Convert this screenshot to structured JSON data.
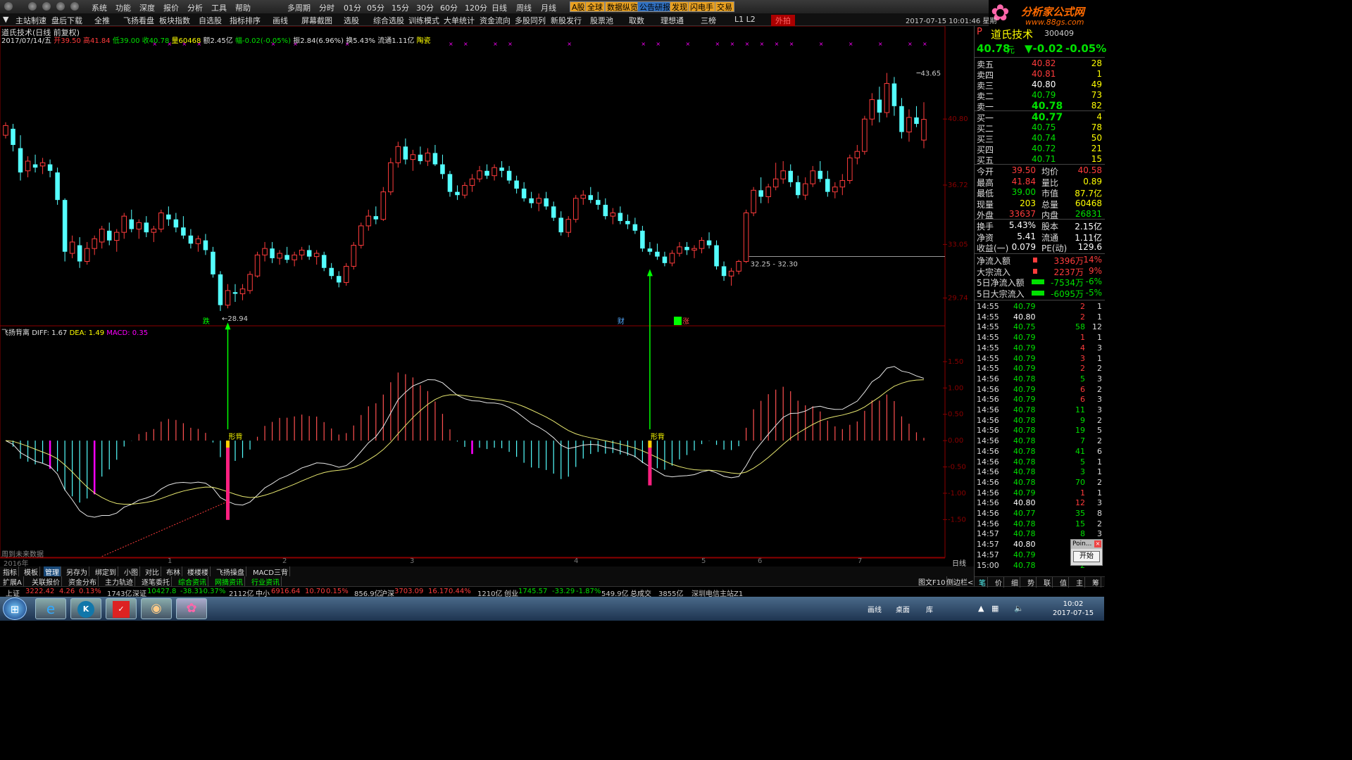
{
  "menu": [
    "系统",
    "功能",
    "深度",
    "报价",
    "分析",
    "工具",
    "帮助",
    "多周期",
    "分时",
    "01分",
    "05分",
    "15分",
    "30分",
    "60分",
    "120分",
    "日线",
    "周线",
    "月线"
  ],
  "badges": [
    {
      "label": "A股",
      "bg": "#e8a020"
    },
    {
      "label": "全球",
      "bg": "#e8a020"
    },
    {
      "label": "数据纵览",
      "bg": "#e8a020"
    },
    {
      "label": "公告研报",
      "bg": "#3070c0"
    },
    {
      "label": "发现",
      "bg": "#e8a020"
    },
    {
      "label": "闪电手",
      "bg": "#e8a020"
    },
    {
      "label": "交易",
      "bg": "#e8a020"
    }
  ],
  "logo": {
    "name": "分析家公式网",
    "url": "www.88gs.com"
  },
  "toolbar": [
    "主站制速",
    "盘后下载",
    "全推",
    "飞扬看盘",
    "板块指数",
    "自选股",
    "指标排序",
    "画线",
    "屏幕截图",
    "选股",
    "综合选股",
    "训练模式",
    "大单统计",
    "资金流向",
    "多股同列",
    "新股发行",
    "股票池",
    "取数",
    "理想通",
    "三榜",
    "L1 L2",
    "外拍"
  ],
  "datetime": "2017-07-15 10:01:46 星期",
  "stock": {
    "title": "道氏技术(日线 前复权)",
    "date": "2017/07/14/五",
    "open": "开39.50",
    "high": "高41.84",
    "low": "低39.00",
    "close": "收40.78",
    "volume": "量60468",
    "amount": "额2.45亿",
    "change": "幅-0.02(-0.05%)",
    "amplitude": "振2.84(6.96%)",
    "turnover": "换5.43%",
    "float": "流通1.11亿",
    "sector": "陶瓷"
  },
  "price_axis": [
    "40.80",
    "36.72",
    "33.05",
    "29.74"
  ],
  "macd_axis": [
    "1.50",
    "1.00",
    "0.50",
    "0.00",
    "-0.50",
    "-1.00",
    "-1.50"
  ],
  "indicator": {
    "name": "飞扬背离",
    "diff": "DIFF: 1.67",
    "dea": "DEA: 1.49",
    "macd": "MACD: 0.35"
  },
  "annotations": {
    "low_label": "←28.94",
    "high_label": "43.65",
    "range_label": "32.25 - 32.30",
    "die_label": "跌",
    "cai_label": "财",
    "zhang_label": "涨",
    "bei1": "形背",
    "bei2": "形背"
  },
  "future_note": "周到未来数据",
  "year_label": "2016年",
  "months": [
    "1",
    "2",
    "3",
    "4",
    "5",
    "6",
    "7"
  ],
  "period_label": "日线",
  "bottom_tabs1": [
    "指标",
    "模板",
    "管理",
    "另存为",
    "绑定到",
    "小图",
    "对比",
    "布林",
    "楼楼楼",
    "飞扬操盘",
    "MACD三背"
  ],
  "bottom_tabs2": [
    "扩展A",
    "关联报价",
    "资金分布",
    "主力轨迹",
    "逐笔委托",
    "综合资讯",
    "网摘资讯",
    "行业资讯"
  ],
  "bottom_right_tabs": [
    "图文F10",
    "侧边栏<"
  ],
  "index_bar": [
    {
      "t": "上证",
      "c": "#ddd"
    },
    {
      "t": "3222.42",
      "c": "#ff3c3c"
    },
    {
      "t": "4.26",
      "c": "#ff3c3c"
    },
    {
      "t": "0.13%",
      "c": "#ff3c3c"
    },
    {
      "t": "1743亿",
      "c": "#ccc"
    },
    {
      "t": "深证",
      "c": "#ddd"
    },
    {
      "t": "10427.8",
      "c": "#00e000"
    },
    {
      "t": "-38.31",
      "c": "#00e000"
    },
    {
      "t": "-0.37%",
      "c": "#00e000"
    },
    {
      "t": "2112亿",
      "c": "#ccc"
    },
    {
      "t": "中小",
      "c": "#ddd"
    },
    {
      "t": "6916.64",
      "c": "#ff3c3c"
    },
    {
      "t": "10.70",
      "c": "#ff3c3c"
    },
    {
      "t": "0.15%",
      "c": "#ff3c3c"
    },
    {
      "t": "856.9亿",
      "c": "#ccc"
    },
    {
      "t": "沪深",
      "c": "#ddd"
    },
    {
      "t": "3703.09",
      "c": "#ff3c3c"
    },
    {
      "t": "16.17",
      "c": "#ff3c3c"
    },
    {
      "t": "0.44%",
      "c": "#ff3c3c"
    },
    {
      "t": "1210亿",
      "c": "#ccc"
    },
    {
      "t": "创业",
      "c": "#ddd"
    },
    {
      "t": "1745.57",
      "c": "#00e000"
    },
    {
      "t": "-33.29",
      "c": "#00e000"
    },
    {
      "t": "-1.87%",
      "c": "#00e000"
    },
    {
      "t": "549.9亿",
      "c": "#ccc"
    },
    {
      "t": "总成交",
      "c": "#ddd"
    },
    {
      "t": "3855亿",
      "c": "#ccc"
    },
    {
      "t": "深圳电信主站Z1",
      "c": "#ccc"
    }
  ],
  "right": {
    "code": "300409",
    "name": "道氏技术",
    "price": "40.78",
    "price_suffix": "元",
    "change": "▼-0.02",
    "pct": "-0.05%",
    "asks": [
      {
        "label": "卖五",
        "price": "40.82",
        "vol": "28"
      },
      {
        "label": "卖四",
        "price": "40.81",
        "vol": "1"
      },
      {
        "label": "卖三",
        "price": "40.80",
        "vol": "49"
      },
      {
        "label": "卖二",
        "price": "40.79",
        "vol": "73"
      },
      {
        "label": "卖一",
        "price": "40.78",
        "vol": "82"
      }
    ],
    "bids": [
      {
        "label": "买一",
        "price": "40.77",
        "vol": "4"
      },
      {
        "label": "买二",
        "price": "40.75",
        "vol": "78"
      },
      {
        "label": "买三",
        "price": "40.74",
        "vol": "50"
      },
      {
        "label": "买四",
        "price": "40.72",
        "vol": "21"
      },
      {
        "label": "买五",
        "price": "40.71",
        "vol": "15"
      }
    ],
    "stats": [
      {
        "l1": "今开",
        "v1": "39.50",
        "l2": "均价",
        "v2": "40.58"
      },
      {
        "l1": "最高",
        "v1": "41.84",
        "l2": "量比",
        "v2": "0.89"
      },
      {
        "l1": "最低",
        "v1": "39.00",
        "l2": "市值",
        "v2": "87.7亿"
      },
      {
        "l1": "现量",
        "v1": "203",
        "l2": "总量",
        "v2": "60468"
      },
      {
        "l1": "外盘",
        "v1": "33637",
        "l2": "内盘",
        "v2": "26831"
      }
    ],
    "stats2": [
      {
        "l1": "换手",
        "v1": "5.43%",
        "l2": "股本",
        "v2": "2.15亿"
      },
      {
        "l1": "净资",
        "v1": "5.41",
        "l2": "流通",
        "v2": "1.11亿"
      },
      {
        "l1": "收益(一)",
        "v1": "0.079",
        "l2": "PE(动)",
        "v2": "129.6"
      }
    ],
    "flows": [
      {
        "label": "净流入额",
        "val": "3396万",
        "pct": "14%",
        "color": "#ff3c3c"
      },
      {
        "label": "大宗流入",
        "val": "2237万",
        "pct": "9%",
        "color": "#ff3c3c"
      },
      {
        "label": "5日净流入额",
        "val": "-7534万",
        "pct": "-6%",
        "color": "#00e000"
      },
      {
        "label": "5日大宗流入",
        "val": "-6095万",
        "pct": "-5%",
        "color": "#00e000"
      }
    ],
    "ticks": [
      [
        "14:55",
        "40.79",
        "2",
        "1"
      ],
      [
        "14:55",
        "40.80",
        "2",
        "1"
      ],
      [
        "14:55",
        "40.75",
        "58",
        "12"
      ],
      [
        "14:55",
        "40.79",
        "1",
        "1"
      ],
      [
        "14:55",
        "40.79",
        "4",
        "3"
      ],
      [
        "14:55",
        "40.79",
        "3",
        "1"
      ],
      [
        "14:55",
        "40.79",
        "2",
        "2"
      ],
      [
        "14:56",
        "40.78",
        "5",
        "3"
      ],
      [
        "14:56",
        "40.79",
        "6",
        "2"
      ],
      [
        "14:56",
        "40.79",
        "6",
        "3"
      ],
      [
        "14:56",
        "40.78",
        "11",
        "3"
      ],
      [
        "14:56",
        "40.78",
        "9",
        "2"
      ],
      [
        "14:56",
        "40.78",
        "19",
        "5"
      ],
      [
        "14:56",
        "40.78",
        "7",
        "2"
      ],
      [
        "14:56",
        "40.78",
        "41",
        "6"
      ],
      [
        "14:56",
        "40.78",
        "5",
        "1"
      ],
      [
        "14:56",
        "40.78",
        "3",
        "1"
      ],
      [
        "14:56",
        "40.78",
        "70",
        "2"
      ],
      [
        "14:56",
        "40.79",
        "1",
        "1"
      ],
      [
        "14:56",
        "40.80",
        "12",
        "3"
      ],
      [
        "14:56",
        "40.77",
        "35",
        "8"
      ],
      [
        "14:56",
        "40.78",
        "15",
        "2"
      ],
      [
        "14:57",
        "40.78",
        "8",
        "3"
      ],
      [
        "14:57",
        "40.80",
        "",
        ""
      ],
      [
        "14:57",
        "40.79",
        "",
        ""
      ],
      [
        "15:00",
        "40.78",
        "2",
        ""
      ]
    ],
    "bottom_tabs": [
      "笔",
      "价",
      "细",
      "势",
      "联",
      "值",
      "主",
      "筹"
    ],
    "popup": {
      "title": "Poin...",
      "button": "开始"
    }
  },
  "clock": {
    "time": "10:02",
    "date": "2017-07-15"
  },
  "tray": [
    "画线",
    "桌面",
    "库"
  ],
  "chart_data": {
    "type": "candlestick",
    "title": "道氏技术(日线 前复权)",
    "ohlc_approx": [
      [
        39.8,
        40.6,
        39.6,
        40.4
      ],
      [
        40.2,
        40.5,
        38.8,
        39.2
      ],
      [
        39.0,
        39.8,
        37.0,
        37.5
      ],
      [
        37.6,
        38.5,
        37.2,
        38.2
      ],
      [
        38.0,
        38.6,
        37.5,
        37.8
      ],
      [
        37.9,
        38.4,
        37.4,
        38.1
      ],
      [
        38.0,
        38.3,
        37.2,
        37.6
      ],
      [
        37.5,
        37.8,
        35.5,
        35.8
      ],
      [
        35.8,
        35.9,
        32.0,
        32.6
      ],
      [
        32.5,
        33.6,
        32.2,
        33.2
      ],
      [
        33.0,
        33.5,
        31.6,
        32.0
      ],
      [
        32.0,
        33.2,
        31.8,
        32.8
      ],
      [
        32.8,
        33.6,
        32.4,
        33.4
      ],
      [
        33.2,
        34.2,
        32.8,
        34.0
      ],
      [
        33.9,
        34.4,
        33.0,
        33.3
      ],
      [
        33.3,
        34.0,
        32.6,
        33.8
      ],
      [
        33.8,
        35.0,
        33.4,
        34.8
      ],
      [
        34.6,
        35.2,
        33.8,
        34.0
      ],
      [
        34.0,
        34.6,
        33.4,
        34.4
      ],
      [
        34.4,
        34.8,
        33.5,
        33.8
      ],
      [
        33.8,
        34.2,
        33.2,
        34.0
      ],
      [
        34.0,
        35.2,
        33.8,
        35.0
      ],
      [
        34.9,
        35.4,
        34.2,
        34.6
      ],
      [
        34.6,
        35.0,
        33.8,
        34.1
      ],
      [
        34.1,
        34.8,
        33.4,
        33.6
      ],
      [
        33.6,
        34.0,
        32.8,
        33.1
      ],
      [
        33.1,
        33.6,
        32.6,
        33.4
      ],
      [
        33.3,
        33.7,
        32.4,
        32.7
      ],
      [
        32.6,
        32.9,
        31.0,
        31.2
      ],
      [
        31.2,
        31.4,
        28.94,
        29.3
      ],
      [
        29.3,
        30.6,
        29.1,
        30.2
      ],
      [
        30.1,
        30.6,
        29.5,
        30.0
      ],
      [
        30.0,
        30.6,
        29.6,
        30.3
      ],
      [
        30.2,
        31.4,
        30.0,
        31.2
      ],
      [
        31.1,
        32.6,
        31.0,
        32.4
      ],
      [
        32.4,
        33.2,
        32.0,
        32.8
      ],
      [
        32.8,
        33.2,
        31.9,
        32.2
      ],
      [
        32.2,
        32.7,
        31.8,
        32.5
      ],
      [
        32.4,
        32.9,
        31.9,
        32.1
      ],
      [
        32.1,
        32.6,
        31.7,
        32.4
      ],
      [
        32.4,
        32.9,
        32.1,
        32.7
      ],
      [
        32.7,
        33.0,
        32.1,
        32.3
      ],
      [
        32.3,
        32.7,
        31.8,
        32.5
      ],
      [
        32.4,
        32.6,
        31.4,
        31.6
      ],
      [
        31.6,
        31.9,
        30.9,
        31.1
      ],
      [
        31.1,
        31.4,
        30.4,
        30.7
      ],
      [
        30.7,
        31.9,
        30.5,
        31.7
      ],
      [
        31.7,
        33.2,
        31.5,
        33.0
      ],
      [
        33.0,
        34.4,
        32.8,
        34.2
      ],
      [
        34.2,
        35.2,
        33.9,
        34.8
      ],
      [
        34.8,
        35.4,
        34.3,
        34.6
      ],
      [
        34.6,
        36.6,
        34.5,
        36.3
      ],
      [
        36.3,
        38.4,
        36.1,
        38.1
      ],
      [
        38.1,
        39.4,
        37.8,
        39.1
      ],
      [
        39.1,
        39.6,
        38.0,
        38.3
      ],
      [
        38.3,
        38.9,
        37.6,
        38.6
      ],
      [
        38.6,
        39.1,
        38.0,
        38.2
      ],
      [
        38.2,
        39.0,
        37.9,
        38.7
      ],
      [
        38.7,
        39.2,
        37.9,
        38.0
      ],
      [
        38.0,
        38.6,
        37.1,
        37.4
      ],
      [
        37.4,
        37.6,
        36.0,
        36.3
      ],
      [
        36.3,
        36.7,
        35.8,
        36.1
      ],
      [
        36.1,
        36.9,
        35.9,
        36.7
      ],
      [
        36.7,
        37.4,
        36.3,
        37.1
      ],
      [
        37.1,
        37.9,
        36.9,
        37.6
      ],
      [
        37.6,
        38.0,
        37.1,
        37.3
      ],
      [
        37.3,
        38.0,
        37.0,
        37.8
      ],
      [
        37.8,
        38.2,
        37.2,
        37.6
      ],
      [
        37.6,
        37.9,
        36.8,
        37.0
      ],
      [
        37.0,
        37.3,
        36.2,
        36.5
      ],
      [
        36.5,
        36.9,
        35.7,
        35.9
      ],
      [
        35.9,
        36.3,
        35.3,
        35.6
      ],
      [
        35.6,
        36.2,
        35.1,
        35.9
      ],
      [
        35.9,
        36.3,
        35.2,
        35.4
      ],
      [
        35.4,
        35.7,
        34.5,
        34.7
      ],
      [
        34.7,
        35.1,
        33.6,
        33.8
      ],
      [
        33.8,
        34.8,
        33.5,
        34.6
      ],
      [
        34.6,
        36.1,
        34.4,
        35.9
      ],
      [
        35.9,
        36.4,
        35.5,
        36.1
      ],
      [
        36.1,
        36.6,
        35.6,
        35.8
      ],
      [
        35.8,
        36.3,
        35.2,
        35.5
      ],
      [
        35.5,
        35.9,
        34.6,
        34.8
      ],
      [
        34.8,
        35.3,
        34.3,
        35.0
      ],
      [
        35.0,
        35.4,
        34.3,
        34.5
      ],
      [
        34.5,
        34.9,
        34.0,
        34.3
      ],
      [
        34.3,
        34.7,
        33.7,
        33.9
      ],
      [
        33.9,
        34.2,
        32.6,
        32.8
      ],
      [
        32.8,
        33.2,
        32.4,
        32.6
      ],
      [
        32.6,
        33.1,
        32.1,
        32.3
      ],
      [
        32.3,
        32.6,
        31.7,
        31.9
      ],
      [
        31.9,
        32.7,
        31.7,
        32.5
      ],
      [
        32.5,
        33.2,
        32.3,
        32.9
      ],
      [
        32.9,
        33.2,
        32.4,
        32.7
      ],
      [
        32.7,
        33.0,
        32.2,
        32.8
      ],
      [
        32.8,
        33.5,
        32.5,
        33.3
      ],
      [
        33.3,
        33.8,
        32.8,
        33.0
      ],
      [
        33.0,
        33.3,
        31.5,
        31.7
      ],
      [
        31.7,
        32.0,
        30.8,
        31.1
      ],
      [
        31.1,
        31.6,
        30.5,
        31.4
      ],
      [
        31.4,
        32.1,
        31.2,
        32.0
      ],
      [
        32.0,
        35.2,
        31.9,
        35.0
      ],
      [
        35.0,
        36.6,
        34.8,
        36.4
      ],
      [
        36.4,
        37.2,
        35.6,
        36.0
      ],
      [
        36.0,
        36.8,
        35.6,
        36.6
      ],
      [
        36.6,
        38.1,
        36.4,
        37.1
      ],
      [
        37.1,
        38.2,
        36.8,
        37.6
      ],
      [
        37.6,
        38.0,
        36.6,
        36.9
      ],
      [
        36.9,
        37.3,
        35.9,
        36.1
      ],
      [
        36.1,
        37.2,
        35.8,
        36.8
      ],
      [
        36.8,
        37.9,
        36.6,
        37.6
      ],
      [
        37.6,
        38.2,
        36.9,
        37.1
      ],
      [
        37.1,
        37.6,
        36.0,
        36.3
      ],
      [
        36.3,
        36.9,
        35.9,
        36.6
      ],
      [
        36.6,
        37.4,
        36.1,
        37.0
      ],
      [
        37.0,
        38.6,
        36.8,
        38.4
      ],
      [
        38.4,
        39.2,
        38.0,
        38.8
      ],
      [
        38.8,
        41.0,
        38.6,
        40.8
      ],
      [
        40.8,
        42.4,
        40.4,
        42.0
      ],
      [
        42.0,
        42.8,
        40.6,
        41.2
      ],
      [
        41.2,
        43.65,
        40.9,
        43.0
      ],
      [
        43.0,
        43.4,
        41.0,
        41.6
      ],
      [
        41.6,
        42.1,
        39.6,
        40.0
      ],
      [
        40.0,
        41.4,
        39.4,
        40.9
      ],
      [
        40.9,
        41.6,
        40.3,
        40.5
      ],
      [
        39.5,
        41.84,
        39.0,
        40.78
      ]
    ]
  }
}
